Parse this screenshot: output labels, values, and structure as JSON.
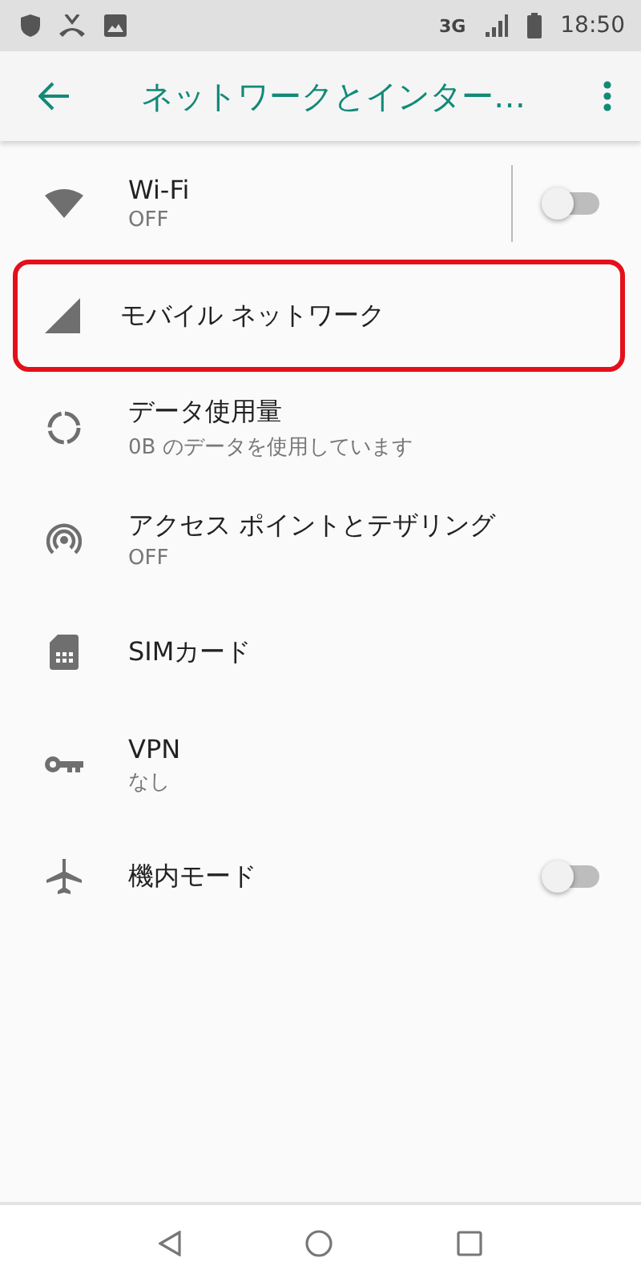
{
  "status_bar": {
    "network": "3G",
    "time": "18:50"
  },
  "app_bar": {
    "title": "ネットワークとインター…"
  },
  "items": [
    {
      "title": "Wi-Fi",
      "summary": "OFF",
      "kind": "toggle",
      "on": false,
      "divider": true,
      "highlighted": false
    },
    {
      "title": "モバイル ネットワーク",
      "kind": "plain",
      "highlighted": true
    },
    {
      "title": "データ使用量",
      "summary": "0B のデータを使用しています",
      "kind": "plain",
      "highlighted": false
    },
    {
      "title": "アクセス ポイントとテザリング",
      "summary": "OFF",
      "kind": "plain",
      "highlighted": false
    },
    {
      "title": "SIMカード",
      "kind": "plain",
      "highlighted": false
    },
    {
      "title": "VPN",
      "summary": "なし",
      "kind": "plain",
      "highlighted": false
    },
    {
      "title": "機内モード",
      "kind": "toggle",
      "on": false,
      "divider": false,
      "highlighted": false
    }
  ]
}
